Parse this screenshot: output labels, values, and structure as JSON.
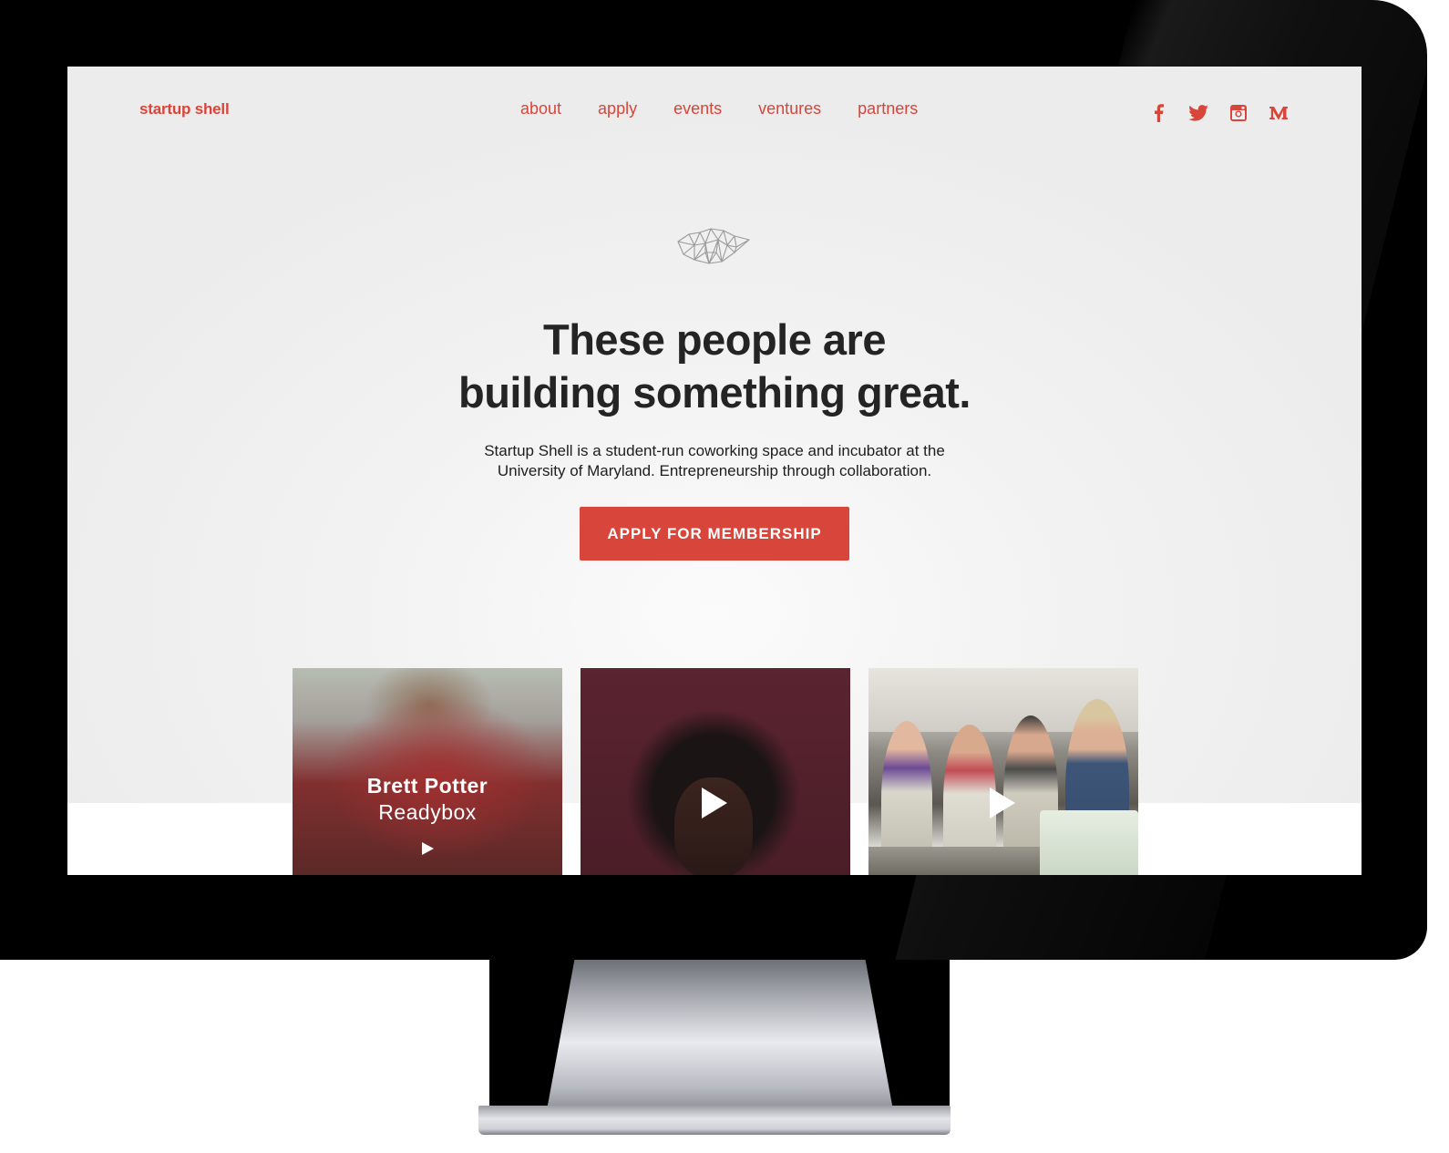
{
  "brand": {
    "name": "startup shell",
    "color": "#d8453a"
  },
  "nav": {
    "links": [
      "about",
      "apply",
      "events",
      "ventures",
      "partners"
    ]
  },
  "social": [
    {
      "icon": "facebook-icon",
      "glyph": "f"
    },
    {
      "icon": "twitter-icon",
      "glyph": "twitter"
    },
    {
      "icon": "instagram-icon",
      "glyph": "instagram"
    },
    {
      "icon": "medium-icon",
      "glyph": "M"
    }
  ],
  "hero": {
    "headline_line1": "These people are",
    "headline_line2": "building something great.",
    "subtext_line1": "Startup Shell is a student-run coworking space and incubator at the",
    "subtext_line2": "University of Maryland. Entrepreneurship through collaboration.",
    "cta_label": "APPLY FOR MEMBERSHIP"
  },
  "cards": [
    {
      "name": "Brett Potter",
      "company": "Readybox",
      "icon": "play-icon"
    },
    {
      "icon": "play-icon"
    },
    {
      "icon": "play-icon"
    }
  ],
  "colors": {
    "accent": "#d8453a",
    "heading": "#242424",
    "hero_bg": "#ececec"
  }
}
